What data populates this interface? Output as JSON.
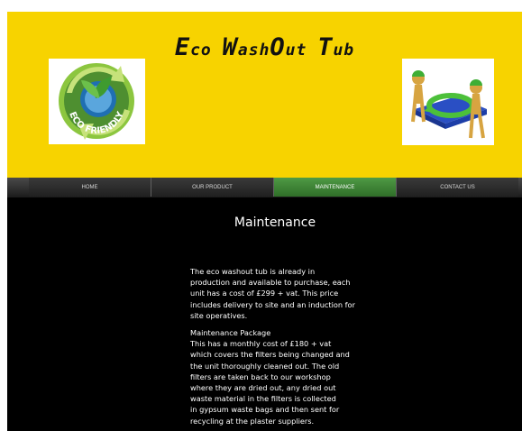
{
  "header": {
    "title_parts": [
      {
        "big": "E",
        "small": "co"
      },
      {
        "big": "W",
        "small": "ash"
      },
      {
        "big": "O",
        "small": "ut"
      },
      {
        "big": "T",
        "small": "ub"
      }
    ],
    "left_logo_text": "ECO FRIENDLY",
    "colors": {
      "background": "#f7d300",
      "accent_green": "#4f9a45"
    }
  },
  "nav": {
    "items": [
      "HOME",
      "OUR PRODUCT",
      "MAINTENANCE",
      "CONTACT US"
    ],
    "active_index": 2
  },
  "main": {
    "heading": "Maintenance",
    "paragraph1": "The eco washout tub is already in\nproduction and available to purchase, each\nunit has a cost of £299 + vat. This price\nincludes delivery to site and an induction for\nsite operatives.",
    "package_title": "Maintenance Package",
    "package_body": "This has a monthly cost of £180 + vat\nwhich covers the filters being changed and\nthe unit thoroughly cleaned out. The old\nfilters are taken back to our workshop\nwhere they are dried out, any dried out\nwaste material in the filters is collected\nin gypsum waste bags and then sent for\nrecycling at the plaster suppliers."
  }
}
